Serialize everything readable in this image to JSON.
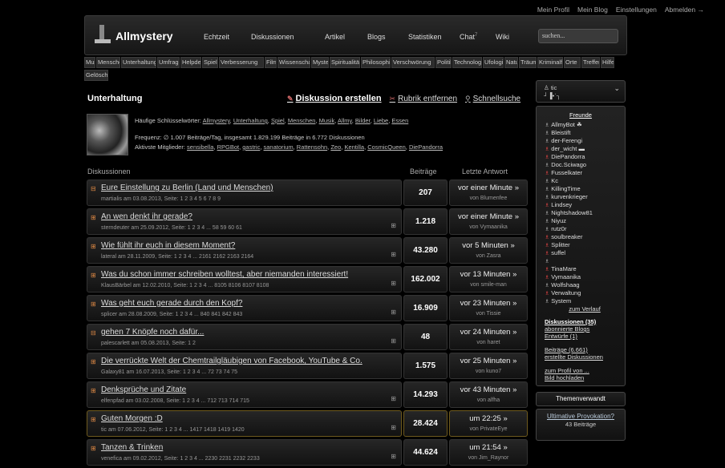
{
  "toplinks": [
    "Mein Profil",
    "Mein Blog",
    "Einstellungen",
    "Abmelden →"
  ],
  "header": {
    "logo": "Allmystery",
    "nav": [
      {
        "label": "Echtzeit",
        "w": 59
      },
      {
        "label": "Diskussionen",
        "w": 92
      },
      {
        "label": "Artikel",
        "w": 53
      },
      {
        "label": "Blogs",
        "w": 51
      },
      {
        "label": "Statistiken",
        "w": 64
      },
      {
        "label": "Chat",
        "w": 45,
        "sup": "7"
      },
      {
        "label": "Wiki",
        "w": 40
      }
    ],
    "search_placeholder": "suchen..."
  },
  "categories": [
    {
      "label": "Musik",
      "w": 14
    },
    {
      "label": "Menschen",
      "w": 30
    },
    {
      "label": "Unterhaltung",
      "w": 44
    },
    {
      "label": "Umfragen",
      "w": 28
    },
    {
      "label": "Helpdesk",
      "w": 26
    },
    {
      "label": "Spiele",
      "w": 20
    },
    {
      "label": "Verbesserung",
      "w": 56
    },
    {
      "label": "Filme",
      "w": 15
    },
    {
      "label": "Wissenschaft",
      "w": 41
    },
    {
      "label": "Mystery",
      "w": 22
    },
    {
      "label": "Spiritualität",
      "w": 38
    },
    {
      "label": "Philosophie",
      "w": 37
    },
    {
      "label": "Verschwörung",
      "w": 54
    },
    {
      "label": "Politik",
      "w": 20
    },
    {
      "label": "Technologie",
      "w": 37
    },
    {
      "label": "Ufologie",
      "w": 26
    },
    {
      "label": "Natur",
      "w": 17
    },
    {
      "label": "Träume",
      "w": 22
    },
    {
      "label": "Kriminalfälle",
      "w": 32
    },
    {
      "label": "Orte",
      "w": 21
    },
    {
      "label": "Treffen",
      "w": 23
    },
    {
      "label": "Hilfe",
      "w": 17
    },
    {
      "label": "Gelöscht",
      "w": 30
    }
  ],
  "page": {
    "title": "Unterhaltung",
    "actions": {
      "create": "Diskussion erstellen",
      "remove": "Rubrik entfernen",
      "search": "Schnellsuche"
    },
    "keywords_label": "Häufige Schlüsselwörter:",
    "keywords": [
      "Allmystery",
      "Unterhaltung",
      "Spiel",
      "Menschen",
      "Musik",
      "Allmy",
      "Bilder",
      "Liebe",
      "Essen"
    ],
    "frequency": "Frequenz: ∅ 1.007 Beiträge/Tag, insgesamt 1.829.199 Beiträge in 6.772 Diskussionen",
    "active_label": "Aktivste Mitglieder:",
    "active_members": [
      "sensibella",
      "RPGBot",
      "gastric",
      "sanatorium",
      "Rattensohn",
      "Zeo",
      "Kentilla",
      "CosmicQueen",
      "DiePandorra"
    ]
  },
  "table_head": {
    "discussions": "Diskussionen",
    "posts": "Beiträge",
    "last": "Letzte Antwort"
  },
  "threads": [
    {
      "title": "Eure Einstellung zu Berlin (Land und Menschen)",
      "meta": "martialis am 03.08.2013, Seite: 1 2 3 4 5 6 7 8 9",
      "count": "207",
      "last_time": "vor einer Minute »",
      "last_user": "von Blumenfee",
      "mark": false,
      "gold": false,
      "icon": "⊟"
    },
    {
      "title": "An wen denkt ihr gerade?",
      "meta": "sterndeuter am 25.09.2012, Seite: 1 2 3 4 ... 58 59 60 61",
      "count": "1.218",
      "last_time": "vor einer Minute »",
      "last_user": "von Vymaanika",
      "mark": true,
      "gold": false,
      "icon": "⊞"
    },
    {
      "title": "Wie fühlt ihr euch in diesem Moment?",
      "meta": "lateral am 28.11.2009, Seite: 1 2 3 4 ... 2161 2162 2163 2164",
      "count": "43.280",
      "last_time": "vor 5 Minuten »",
      "last_user": "von Zasra",
      "mark": true,
      "gold": false,
      "icon": "⊞"
    },
    {
      "title": "Was du schon immer schreiben wolltest, aber niemanden interessiert!",
      "meta": "KlausBärbel am 12.02.2010, Seite: 1 2 3 4 ... 8105 8106 8107 8108",
      "count": "162.002",
      "last_time": "vor 13 Minuten »",
      "last_user": "von smile-man",
      "mark": true,
      "gold": false,
      "icon": "⊞"
    },
    {
      "title": "Was geht euch gerade durch den Kopf?",
      "meta": "splicer am 28.08.2009, Seite: 1 2 3 4 ... 840 841 842 843",
      "count": "16.909",
      "last_time": "vor 23 Minuten »",
      "last_user": "von Tissie",
      "mark": true,
      "gold": false,
      "icon": "⊞"
    },
    {
      "title": "gehen 7 Knöpfe noch dafür...",
      "meta": "palescarlett am 05.08.2013, Seite: 1 2",
      "count": "48",
      "last_time": "vor 24 Minuten »",
      "last_user": "von haret",
      "mark": true,
      "gold": false,
      "icon": "⊟"
    },
    {
      "title": "Die verrückte Welt der Chemtrailgläubigen von Facebook, YouTube & Co.",
      "meta": "Galaxy81 am 16.07.2013, Seite: 1 2 3 4 ... 72 73 74 75",
      "count": "1.575",
      "last_time": "vor 25 Minuten »",
      "last_user": "von kuno7",
      "mark": false,
      "gold": false,
      "icon": "⊞"
    },
    {
      "title": "Denksprüche und Zitate",
      "meta": "elfenpfad am 03.02.2008, Seite: 1 2 3 4 ... 712 713 714 715",
      "count": "14.293",
      "last_time": "vor 43 Minuten »",
      "last_user": "von alfha",
      "mark": true,
      "gold": false,
      "icon": "⊞"
    },
    {
      "title": "Guten Morgen :D",
      "meta": "tic am 07.06.2012, Seite: 1 2 3 4 ... 1417 1418 1419 1420",
      "count": "28.424",
      "last_time": "um 22:25 »",
      "last_user": "von PrivateEye",
      "mark": true,
      "gold": true,
      "icon": "⊞"
    },
    {
      "title": "Tanzen & Trinken",
      "meta": "venefica am 09.02.2012, Seite: 1 2 3 4 ... 2230 2231 2232 2233",
      "count": "44.624",
      "last_time": "um 21:54 »",
      "last_user": "von Jim_Raynor",
      "mark": true,
      "gold": false,
      "icon": "⊞"
    }
  ],
  "sidebar": {
    "user": "tic",
    "user_sub": "┘▐•ˈ┐",
    "friends_title": "Freunde",
    "friends": [
      {
        "name": "AllmyBot",
        "red": false,
        "extra": "☘"
      },
      {
        "name": "Bleistift",
        "red": false
      },
      {
        "name": "der-Ferengi",
        "red": false
      },
      {
        "name": "der_wicht",
        "red": true,
        "extra": "▬"
      },
      {
        "name": "DiePandorra",
        "red": true
      },
      {
        "name": "Doc.Sciwago",
        "red": false
      },
      {
        "name": "Fusselkater",
        "red": true
      },
      {
        "name": "Kc",
        "red": false
      },
      {
        "name": "KillingTime",
        "red": false
      },
      {
        "name": "kurvenkrieger",
        "red": false
      },
      {
        "name": "Lindsey",
        "red": true
      },
      {
        "name": "Nightshadow81",
        "red": false
      },
      {
        "name": "Niyuz",
        "red": false
      },
      {
        "name": "rutz0r",
        "red": false
      },
      {
        "name": "soulbreaker",
        "red": true
      },
      {
        "name": "Splitter",
        "red": true
      },
      {
        "name": "suffel",
        "red": true
      },
      {
        "name": "",
        "red": false
      },
      {
        "name": "TinaMare",
        "red": true
      },
      {
        "name": "Vymaanika",
        "red": true
      },
      {
        "name": "Wolfshaag",
        "red": false
      },
      {
        "name": "Verwaltung",
        "red": true
      },
      {
        "name": "System",
        "red": false
      }
    ],
    "verlauf": "zum Verlauf",
    "links1": [
      "Diskussionen (35)",
      "abonnierte Blogs",
      "Entwürfe (1)"
    ],
    "links2": [
      "Beiträge (6.661)",
      "erstellte Diskussionen"
    ],
    "links3": [
      "zum Profil von ...",
      "Bild hochladen"
    ],
    "related_btn": "Themenverwandt",
    "related_title": "Ultimative Provokation?",
    "related_count": "43 Beiträge"
  }
}
